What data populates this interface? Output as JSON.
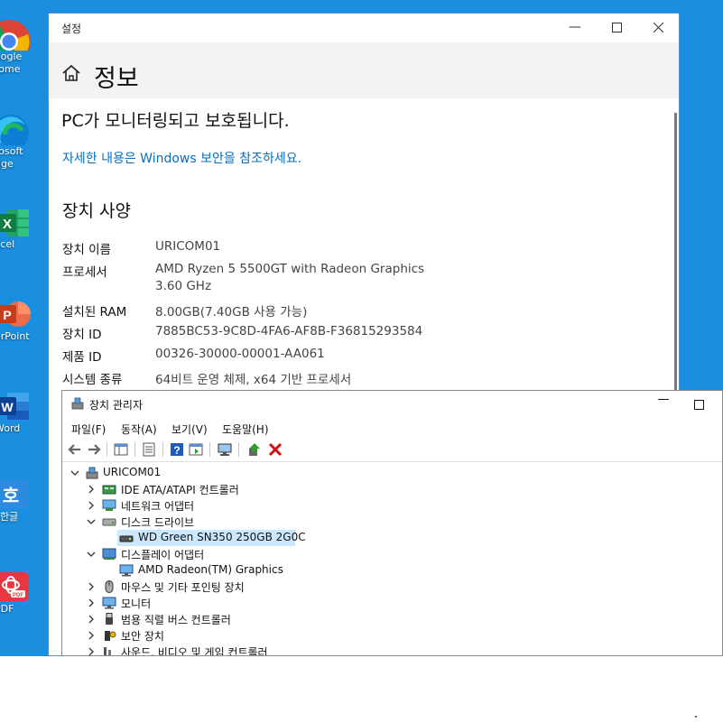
{
  "desktop": {
    "icons": [
      {
        "line1": "oogle",
        "line2": "rome"
      },
      {
        "line1": "rosoft",
        "line2": "dge"
      },
      {
        "line1": "xcel",
        "line2": ""
      },
      {
        "line1": "erPoint",
        "line2": ""
      },
      {
        "line1": "Word",
        "line2": ""
      },
      {
        "line1": "한글",
        "line2": ""
      },
      {
        "line1": "PDF",
        "line2": ""
      }
    ]
  },
  "settings": {
    "window_title": "설정",
    "header_title": "정보",
    "protected_text": "PC가 모니터링되고 보호됩니다.",
    "security_link": "자세한 내용은 Windows 보안을 참조하세요.",
    "specs_heading": "장치 사양",
    "specs": [
      {
        "label": "장치 이름",
        "value": "URICOM01",
        "value2": ""
      },
      {
        "label": "프로세서",
        "value": "AMD Ryzen 5 5500GT with Radeon Graphics",
        "value2": "3.60 GHz"
      },
      {
        "label": "설치된 RAM",
        "value": "8.00GB(7.40GB 사용 가능)",
        "value2": ""
      },
      {
        "label": "장치 ID",
        "value": "7885BC53-9C8D-4FA6-AF8B-F36815293584",
        "value2": ""
      },
      {
        "label": "제품 ID",
        "value": "00326-30000-00001-AA061",
        "value2": ""
      },
      {
        "label": "시스템 종류",
        "value": "64비트 운영 체제, x64 기반 프로세서",
        "value2": ""
      }
    ]
  },
  "device_manager": {
    "window_title": "장치 관리자",
    "menu": [
      "파일(F)",
      "동작(A)",
      "보기(V)",
      "도움말(H)"
    ],
    "root": "URICOM01",
    "tree": [
      {
        "label": "IDE ATA/ATAPI 컨트롤러",
        "level": 1,
        "state": "collapsed",
        "icon": "ide-controller-icon"
      },
      {
        "label": "네트워크 어댑터",
        "level": 1,
        "state": "collapsed",
        "icon": "network-adapter-icon"
      },
      {
        "label": "디스크 드라이브",
        "level": 1,
        "state": "expanded",
        "icon": "disk-drive-icon"
      },
      {
        "label": "WD Green SN350 250GB 2G0C",
        "level": 2,
        "state": "leaf",
        "icon": "disk-icon",
        "selected": true
      },
      {
        "label": "디스플레이 어댑터",
        "level": 1,
        "state": "expanded",
        "icon": "display-adapter-icon"
      },
      {
        "label": "AMD Radeon(TM) Graphics",
        "level": 2,
        "state": "leaf",
        "icon": "monitor-icon"
      },
      {
        "label": "마우스 및 기타 포인팅 장치",
        "level": 1,
        "state": "collapsed",
        "icon": "mouse-icon"
      },
      {
        "label": "모니터",
        "level": 1,
        "state": "collapsed",
        "icon": "monitor-icon"
      },
      {
        "label": "범용 직렬 버스 컨트롤러",
        "level": 1,
        "state": "collapsed",
        "icon": "usb-icon"
      },
      {
        "label": "보안 장치",
        "level": 1,
        "state": "collapsed",
        "icon": "security-device-icon"
      },
      {
        "label": "사운드, 비디오 및 게임 컨트롤러",
        "level": 1,
        "state": "collapsed",
        "icon": "sound-icon"
      }
    ]
  },
  "colors": {
    "desktop_bg": "#1a8fe0",
    "link": "#0a6cbf",
    "selection": "#cce8ff",
    "delete_red": "#d01010"
  }
}
